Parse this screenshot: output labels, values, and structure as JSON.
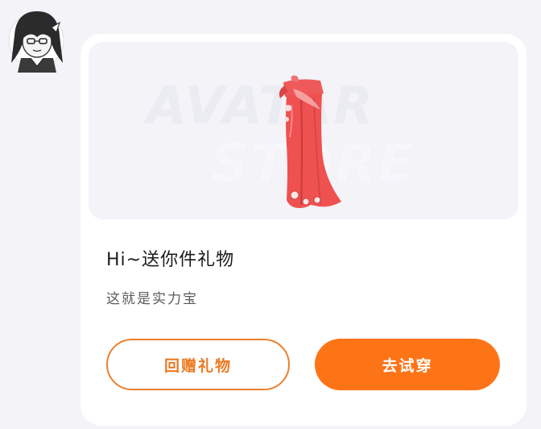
{
  "watermark": {
    "line1": "AVATAR",
    "line2": "STORE"
  },
  "card": {
    "title": "Hi~送你件礼物",
    "subtitle": "这就是实力宝"
  },
  "buttons": {
    "return_gift": "回赠礼物",
    "try_on": "去试穿"
  },
  "colors": {
    "accent": "#fd7417",
    "outline_accent": "#ec7f2e",
    "page_background": "#f4f4f8",
    "preview_background": "#f3f3f8",
    "item_red": "#ef4f4f"
  },
  "icons": {
    "avatar": "anime-girl-avatar",
    "item": "red-skirt-gift-item"
  }
}
